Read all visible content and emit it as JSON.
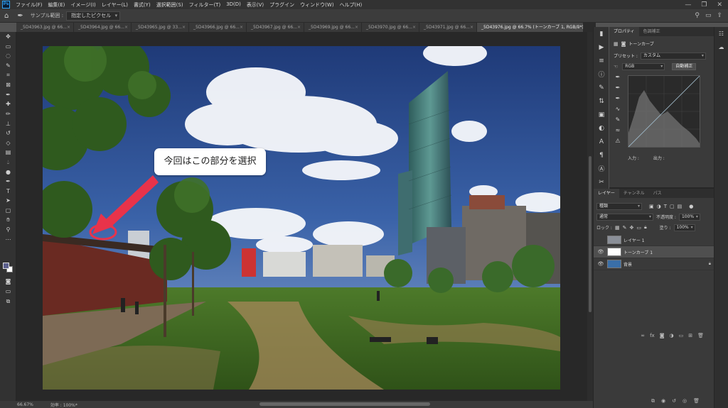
{
  "app": {
    "logo": "Ps"
  },
  "menubar": {
    "items": [
      "ファイル(F)",
      "編集(E)",
      "イメージ(I)",
      "レイヤー(L)",
      "書式(Y)",
      "選択範囲(S)",
      "フィルター(T)",
      "3D(D)",
      "表示(V)",
      "プラグイン",
      "ウィンドウ(W)",
      "ヘルプ(H)"
    ],
    "controls": [
      "—",
      "❐",
      "✕"
    ]
  },
  "optionsbar": {
    "sample_size_label": "サンプル範囲 :",
    "sample_size_value": "指定したピクセル"
  },
  "tabs": [
    {
      "label": "_5D43963.jpg @ 66...",
      "active": false
    },
    {
      "label": "_5D43964.jpg @ 66...",
      "active": false
    },
    {
      "label": "_5D43965.jpg @ 33...",
      "active": false
    },
    {
      "label": "_5D43966.jpg @ 66...",
      "active": false
    },
    {
      "label": "_5D43967.jpg @ 66...",
      "active": false
    },
    {
      "label": "_5D43969.jpg @ 66...",
      "active": false
    },
    {
      "label": "_5D43970.jpg @ 66...",
      "active": false
    },
    {
      "label": "_5D43971.jpg @ 66...",
      "active": false
    },
    {
      "label": "_5D43976.jpg @ 66.7% (トーンカーブ 1, RGB/8*) *",
      "active": true
    }
  ],
  "callout": {
    "text": "今回はこの部分を選択"
  },
  "statusbar": {
    "zoom": "66.67%",
    "info": "効率 : 100%*"
  },
  "properties": {
    "tabs": [
      "プロパティ",
      "色調補正"
    ],
    "adjustment_name": "トーンカーブ",
    "preset_label": "プリセット :",
    "preset_value": "カスタム",
    "channel_value": "RGB",
    "auto_button": "自動補正",
    "input_label": "入力 :",
    "output_label": "出力 :"
  },
  "layers_panel": {
    "tabs": [
      "レイヤー",
      "チャンネル",
      "パス"
    ],
    "filter_value": "種類",
    "blend_mode": "通常",
    "opacity_label": "不透明度 :",
    "opacity_value": "100%",
    "lock_label": "ロック :",
    "fill_label": "塗り :",
    "fill_value": "100%",
    "layers": [
      {
        "name": "レイヤー 1",
        "visible": false,
        "thumb": "#8a8f98"
      },
      {
        "name": "トーンカーブ 1",
        "visible": true,
        "thumb": "#ffffff"
      },
      {
        "name": "背景",
        "visible": true,
        "thumb": "#3a6fa8"
      }
    ]
  },
  "colors": {
    "accent_red": "#e8334a",
    "panel_bg": "#3a3a3a"
  }
}
